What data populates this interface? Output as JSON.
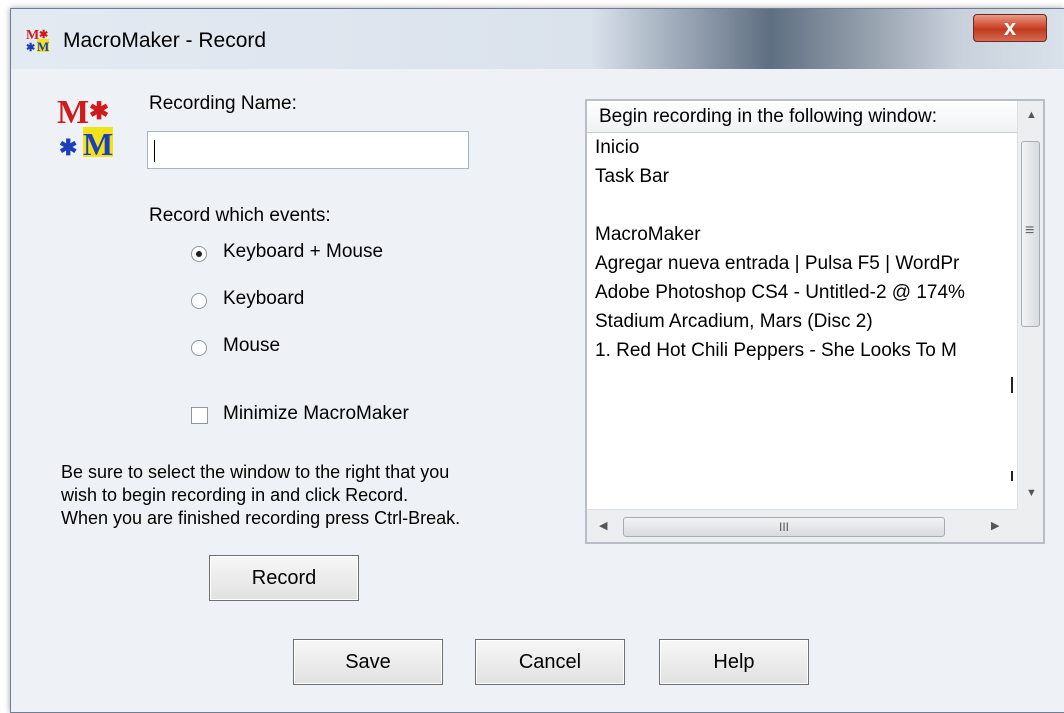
{
  "window": {
    "title": "MacroMaker - Record",
    "close_glyph": "x",
    "icon": "macromaker-logo-icon"
  },
  "form": {
    "recording_name_label": "Recording Name:",
    "recording_name_value": "",
    "events_label": "Record which events:",
    "events_options": [
      {
        "label": "Keyboard + Mouse",
        "selected": true
      },
      {
        "label": "Keyboard",
        "selected": false
      },
      {
        "label": "Mouse",
        "selected": false
      }
    ],
    "minimize_label": "Minimize MacroMaker",
    "minimize_checked": false,
    "instructions": [
      "Be sure to select the window to the right that you",
      "wish to begin recording in and click Record.",
      "When you are finished recording press Ctrl-Break."
    ],
    "record_button": "Record"
  },
  "window_list": {
    "header": "Begin recording in the following window:",
    "items": [
      "Inicio",
      "Task Bar",
      "",
      "MacroMaker",
      "Agregar nueva entrada | Pulsa F5 | WordPr",
      "Adobe Photoshop CS4 - Untitled-2 @ 174%",
      "Stadium Arcadium, Mars (Disc 2)",
      "1. Red Hot Chili Peppers - She Looks To M"
    ],
    "hscroll_grip": "III",
    "vscroll_grip": "≡"
  },
  "footer": {
    "save": "Save",
    "cancel": "Cancel",
    "help": "Help"
  },
  "colors": {
    "dialog_bg": "#eef1f5",
    "close_button": "#c13a20",
    "logo_red": "#d11a1a",
    "logo_blue": "#1f3fb8",
    "logo_yellow": "#f2e21a"
  }
}
